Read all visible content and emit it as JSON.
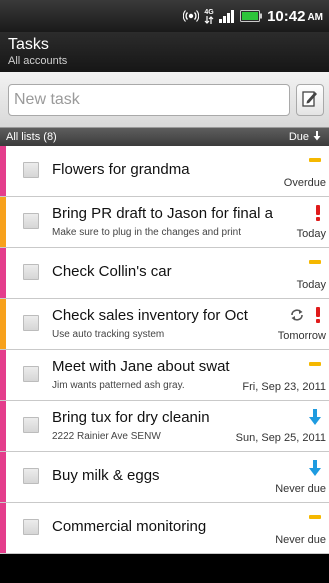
{
  "status_bar": {
    "time": "10:42",
    "ampm": "AM",
    "network_label": "4G",
    "icons": [
      "location-icon",
      "network-4g-icon",
      "signal-icon",
      "battery-icon"
    ]
  },
  "header": {
    "title": "Tasks",
    "subtitle": "All accounts"
  },
  "new_task": {
    "placeholder": "New task",
    "value": ""
  },
  "list_header": {
    "label": "All lists (8)",
    "sort_label": "Due"
  },
  "colors": {
    "pink": "#e43d8c",
    "orange": "#f7a11c",
    "priority_normal": "#f5b800",
    "priority_high": "#e01b1b",
    "priority_low": "#1e9be0"
  },
  "tasks": [
    {
      "title": "Flowers for grandma",
      "note": "",
      "due": "Overdue",
      "strip": "pink",
      "priority": "normal",
      "repeat": false
    },
    {
      "title": "Bring PR draft to Jason for final a",
      "note": "Make sure to plug in the changes and print",
      "due": "Today",
      "strip": "orange",
      "priority": "high",
      "repeat": false
    },
    {
      "title": "Check Collin's car",
      "note": "",
      "due": "Today",
      "strip": "pink",
      "priority": "normal",
      "repeat": false
    },
    {
      "title": "Check sales inventory for Oct",
      "note": "Use auto tracking system",
      "due": "Tomorrow",
      "strip": "orange",
      "priority": "high",
      "repeat": true
    },
    {
      "title": "Meet with Jane about swat",
      "note": "Jim wants patterned ash gray.",
      "due": "Fri, Sep 23, 2011",
      "strip": "pink",
      "priority": "normal",
      "repeat": false
    },
    {
      "title": "Bring tux for dry cleanin",
      "note": "2222 Rainier Ave SENW",
      "due": "Sun, Sep 25, 2011",
      "strip": "pink",
      "priority": "low",
      "repeat": false
    },
    {
      "title": "Buy milk & eggs",
      "note": "",
      "due": "Never due",
      "strip": "pink",
      "priority": "low",
      "repeat": false
    },
    {
      "title": "Commercial monitoring",
      "note": "",
      "due": "Never due",
      "strip": "pink",
      "priority": "normal",
      "repeat": false
    }
  ]
}
